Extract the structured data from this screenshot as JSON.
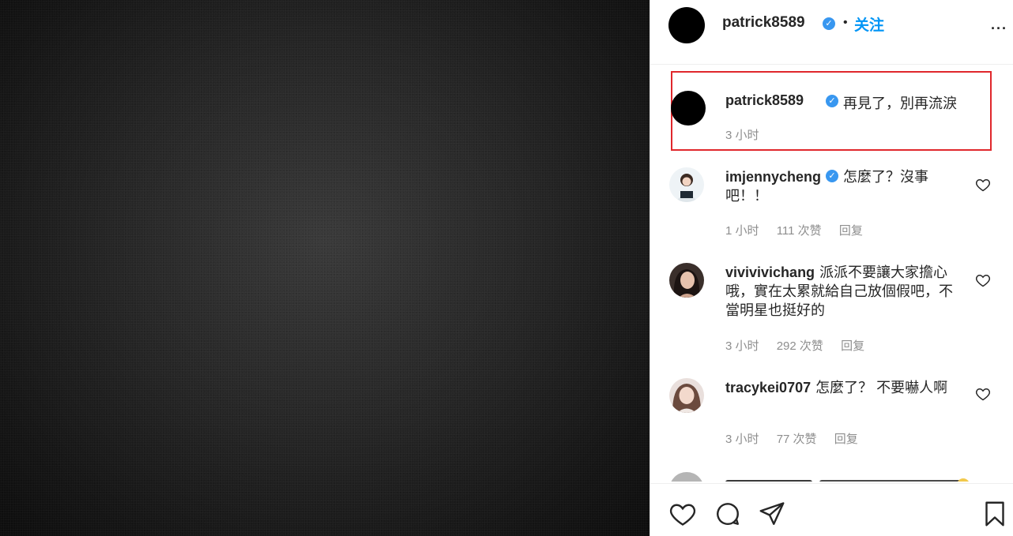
{
  "post": {
    "username": "patrick8589",
    "verified_mark": "✓",
    "dot": "•",
    "follow_label": "关注",
    "more_label": "···"
  },
  "caption": {
    "username": "patrick8589",
    "text": "再見了，別再流淚",
    "time": "3 小时"
  },
  "comments": [
    {
      "username": "imjennycheng",
      "verified": true,
      "text": "怎麼了？沒事吧！！",
      "time": "1 小时",
      "likes": "111 次赞",
      "reply_label": "回复"
    },
    {
      "username": "vivivivichang",
      "verified": false,
      "text": "派派不要讓大家擔心哦，實在太累就給自己放個假吧，不當明星也挺好的",
      "time": "3 小时",
      "likes": "292 次赞",
      "reply_label": "回复"
    },
    {
      "username": "tracykei0707",
      "verified": false,
      "text": "怎麼了？ 不要嚇人啊",
      "time": "3 小时",
      "likes": "77 次赞",
      "reply_label": "回复"
    }
  ],
  "icons": {
    "like": "heart-icon",
    "comment": "comment-icon",
    "share": "send-icon",
    "save": "bookmark-icon"
  },
  "colors": {
    "accent": "#0095f6",
    "verified": "#3897f0",
    "highlight_border": "#e0282c",
    "muted_text": "#8e8e8e"
  }
}
